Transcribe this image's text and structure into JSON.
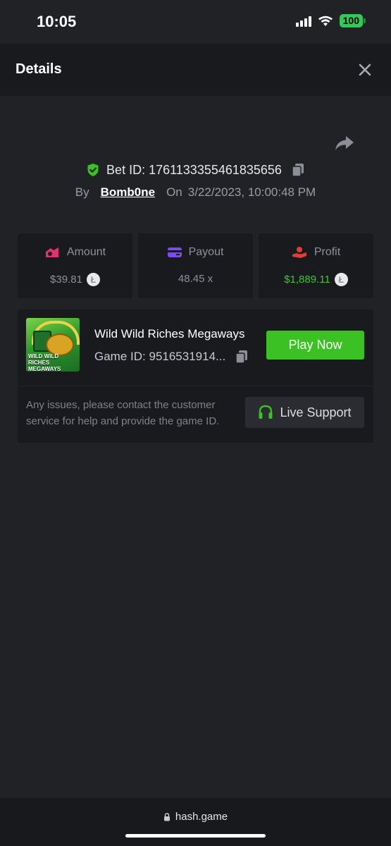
{
  "status_bar": {
    "time": "10:05",
    "battery": "100",
    "icons": [
      "signal-icon",
      "wifi-icon",
      "battery-icon"
    ]
  },
  "header": {
    "title": "Details",
    "close_icon": "close-icon"
  },
  "bet": {
    "id_label": "Bet ID:",
    "id_value": "1761133355461835656",
    "by_label": "By",
    "username": "Bomb0ne",
    "on_label": "On",
    "datetime": "3/22/2023, 10:00:48 PM"
  },
  "stats": {
    "amount": {
      "label": "Amount",
      "value": "$39.81",
      "icon": "amount-icon"
    },
    "payout": {
      "label": "Payout",
      "value": "48.45 x",
      "icon": "payout-card-icon"
    },
    "profit": {
      "label": "Profit",
      "value": "$1,889.11",
      "icon": "profit-icon"
    },
    "coin_symbol": "Ł"
  },
  "game": {
    "name": "Wild Wild Riches Megaways",
    "id_label": "Game ID:",
    "id_value": "9516531914...",
    "thumb_text": "WILD WILD RICHES MEGAWAYS",
    "play_label": "Play Now"
  },
  "support": {
    "help_text": "Any issues, please contact the customer service for help and provide the game ID.",
    "button_label": "Live Support"
  },
  "browser": {
    "url": "hash.game"
  },
  "colors": {
    "background": "#202226",
    "panel": "#191a1e",
    "accent_green": "#3cc125",
    "profit_green": "#3fc535"
  }
}
